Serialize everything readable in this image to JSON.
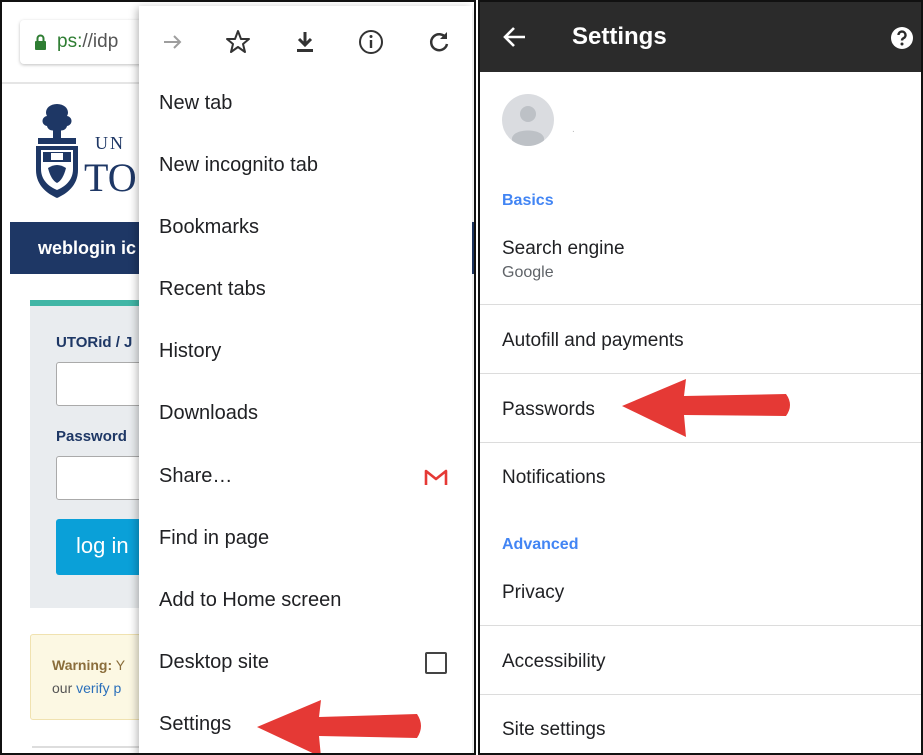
{
  "left_panel": {
    "browser": {
      "url_scheme": "ps:",
      "url_rest": "//idp"
    },
    "site": {
      "logo_line1": "UN",
      "logo_line2": "TO",
      "nav_title": "weblogin ic",
      "utorid_label": "UTORid / J",
      "password_label": "Password",
      "login_button": "log in",
      "warning_label": "Warning:",
      "warning_rest": " Y",
      "warning_line2_pre": "our ",
      "warning_link": "verify p"
    },
    "menu": {
      "icons": [
        "forward-arrow-icon",
        "star-icon",
        "download-icon",
        "info-icon",
        "refresh-icon"
      ],
      "items": [
        {
          "label": "New tab"
        },
        {
          "label": "New incognito tab"
        },
        {
          "label": "Bookmarks"
        },
        {
          "label": "Recent tabs"
        },
        {
          "label": "History"
        },
        {
          "label": "Downloads"
        },
        {
          "label": "Share…"
        },
        {
          "label": "Find in page"
        },
        {
          "label": "Add to Home screen"
        },
        {
          "label": "Desktop site"
        },
        {
          "label": "Settings"
        }
      ],
      "share_icon": "gmail-icon",
      "desktop_site_checked": false
    }
  },
  "right_panel": {
    "appbar": {
      "title": "Settings",
      "back_icon": "back-arrow-icon",
      "help_icon": "help-icon"
    },
    "account_text": ".",
    "sections": {
      "basics": "Basics",
      "advanced": "Advanced"
    },
    "items": {
      "search_engine": "Search engine",
      "search_engine_value": "Google",
      "autofill": "Autofill and payments",
      "passwords": "Passwords",
      "notifications": "Notifications",
      "privacy": "Privacy",
      "accessibility": "Accessibility",
      "site_settings": "Site settings"
    }
  },
  "colors": {
    "annotation_arrow": "#e53935",
    "uoft_navy": "#1e3765",
    "section_header": "#4285f4",
    "appbar": "#2b2b2b",
    "login_button": "#0aa0d8",
    "lock_green": "#2e7d32"
  }
}
